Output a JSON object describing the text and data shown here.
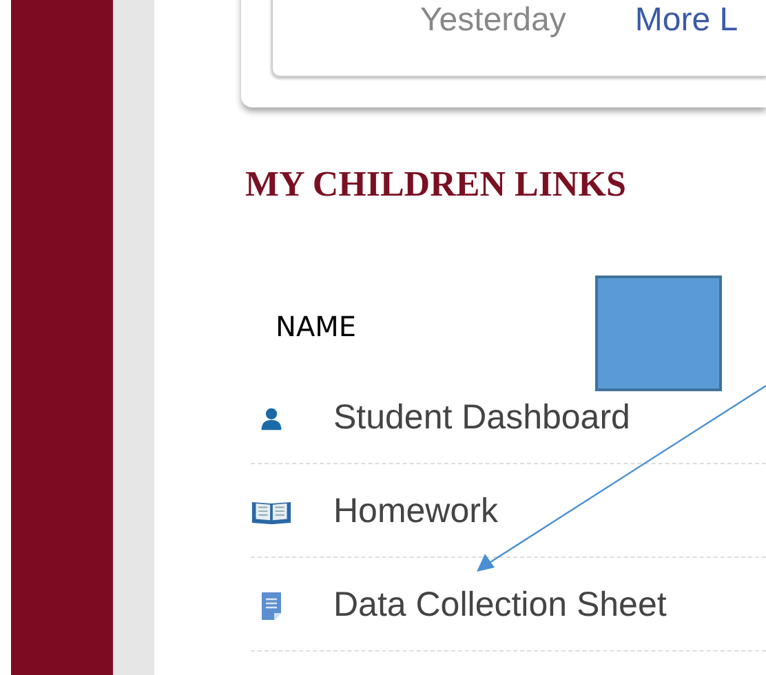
{
  "top_card": {
    "date": "Yesterday",
    "link": "More L"
  },
  "section": {
    "title": "MY CHILDREN LINKS",
    "column_header": "NAME"
  },
  "links": [
    {
      "label": "Student Dashboard",
      "kind": "person"
    },
    {
      "label": "Homework",
      "kind": "book"
    },
    {
      "label": "Data Collection Sheet",
      "kind": "document"
    }
  ]
}
